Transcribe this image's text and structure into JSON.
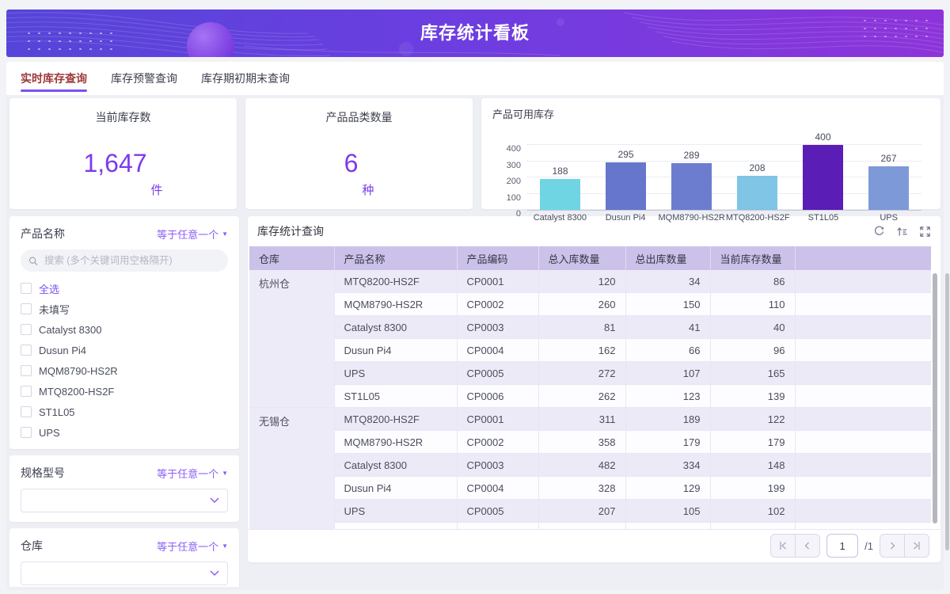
{
  "header": {
    "title": "库存统计看板"
  },
  "tabs": [
    {
      "label": "实时库存查询",
      "active": true
    },
    {
      "label": "库存预警查询",
      "active": false
    },
    {
      "label": "库存期初期末查询",
      "active": false
    }
  ],
  "stats": [
    {
      "title": "当前库存数",
      "value": "1,647",
      "unit": "件"
    },
    {
      "title": "产品品类数量",
      "value": "6",
      "unit": "种"
    }
  ],
  "chart_data": {
    "type": "bar",
    "title": "产品可用库存",
    "categories": [
      "Catalyst 8300",
      "Dusun Pi4",
      "MQM8790-HS2R",
      "MTQ8200-HS2F",
      "ST1L05",
      "UPS"
    ],
    "values": [
      188,
      295,
      289,
      208,
      400,
      267
    ],
    "bar_colors": [
      "#6fd5e2",
      "#6576cc",
      "#6c7dd0",
      "#80c4e6",
      "#5a1db6",
      "#7d99d8"
    ],
    "ylim": [
      0,
      400
    ],
    "yticks": [
      0,
      100,
      200,
      300,
      400
    ],
    "grid": true,
    "xlabel": "",
    "ylabel": ""
  },
  "filters": {
    "product": {
      "label": "产品名称",
      "operator": "等于任意一个",
      "search_placeholder": "搜索 (多个关键词用空格隔开)",
      "options": [
        {
          "label": "全选",
          "accent": true
        },
        {
          "label": "未填写",
          "accent": false
        },
        {
          "label": "Catalyst 8300",
          "accent": false
        },
        {
          "label": "Dusun Pi4",
          "accent": false
        },
        {
          "label": "MQM8790-HS2R",
          "accent": false
        },
        {
          "label": "MTQ8200-HS2F",
          "accent": false
        },
        {
          "label": "ST1L05",
          "accent": false
        },
        {
          "label": "UPS",
          "accent": false
        }
      ]
    },
    "spec": {
      "label": "规格型号",
      "operator": "等于任意一个",
      "value": ""
    },
    "warehouse": {
      "label": "仓库",
      "operator": "等于任意一个",
      "value": ""
    }
  },
  "table": {
    "title": "库存统计查询",
    "columns": [
      "仓库",
      "产品名称",
      "产品编码",
      "总入库数量",
      "总出库数量",
      "当前库存数量"
    ],
    "groups": [
      {
        "warehouse": "杭州仓",
        "rows": [
          [
            "MTQ8200-HS2F",
            "CP0001",
            "120",
            "34",
            "86"
          ],
          [
            "MQM8790-HS2R",
            "CP0002",
            "260",
            "150",
            "110"
          ],
          [
            "Catalyst 8300",
            "CP0003",
            "81",
            "41",
            "40"
          ],
          [
            "Dusun Pi4",
            "CP0004",
            "162",
            "66",
            "96"
          ],
          [
            "UPS",
            "CP0005",
            "272",
            "107",
            "165"
          ],
          [
            "ST1L05",
            "CP0006",
            "262",
            "123",
            "139"
          ]
        ]
      },
      {
        "warehouse": "无锡仓",
        "rows": [
          [
            "MTQ8200-HS2F",
            "CP0001",
            "311",
            "189",
            "122"
          ],
          [
            "MQM8790-HS2R",
            "CP0002",
            "358",
            "179",
            "179"
          ],
          [
            "Catalyst 8300",
            "CP0003",
            "482",
            "334",
            "148"
          ],
          [
            "Dusun Pi4",
            "CP0004",
            "328",
            "129",
            "199"
          ],
          [
            "UPS",
            "CP0005",
            "207",
            "105",
            "102"
          ],
          [
            "",
            "",
            "",
            "",
            ""
          ]
        ]
      }
    ],
    "pagination": {
      "page": "1",
      "total": "/1"
    }
  },
  "colors": {
    "accent": "#7c3aed",
    "operator_purple": "#8b5cf6",
    "active_tab": "#9c3a3a",
    "tab_underline": "#7a52f0",
    "banner_gradient_start": "#5545d8",
    "banner_gradient_end": "#8d34d9",
    "table_header_bg": "#ccc2e9",
    "row_stripe": "#edeaf8"
  }
}
